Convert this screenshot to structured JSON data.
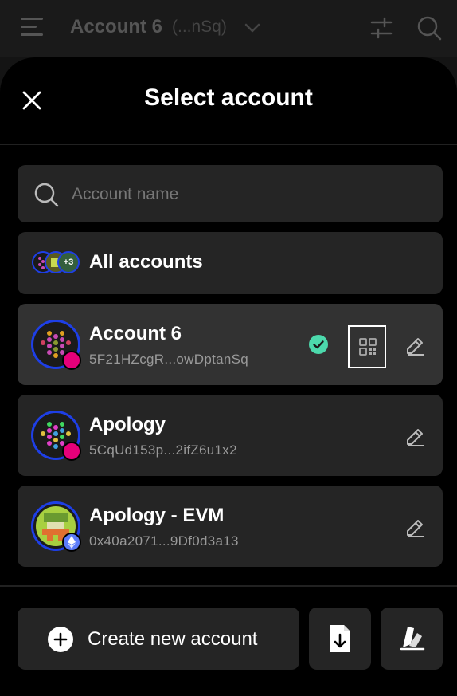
{
  "header": {
    "account_title": "Account 6",
    "account_short_addr": "(...nSq)"
  },
  "modal": {
    "title": "Select account",
    "search_placeholder": "Account name",
    "all_accounts": {
      "label": "All accounts",
      "extra_count": "+3"
    },
    "accounts": [
      {
        "name": "Account 6",
        "address": "5F21HZcgR...owDptanSq",
        "selected": true,
        "network": "polkadot"
      },
      {
        "name": "Apology",
        "address": "5CqUd153p...2ifZ6u1x2",
        "selected": false,
        "network": "polkadot"
      },
      {
        "name": "Apology - EVM",
        "address": "0x40a2071...9Df0d3a13",
        "selected": false,
        "network": "ethereum"
      }
    ],
    "actions": {
      "create_label": "Create new account"
    }
  },
  "colors": {
    "accent_blue": "#1e3fe6",
    "selected_check": "#4cd9ac",
    "polkadot_pink": "#e6007a",
    "eth_blue": "#5c7cfa"
  }
}
